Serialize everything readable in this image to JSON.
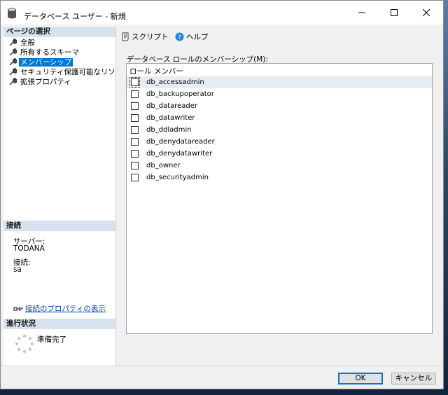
{
  "window": {
    "title": "データベース ユーザー - 新規"
  },
  "left": {
    "select_page_header": "ページの選択",
    "pages": [
      {
        "label": "全般"
      },
      {
        "label": "所有するスキーマ"
      },
      {
        "label": "メンバーシップ"
      },
      {
        "label": "セキュリティ保護可能なリソース"
      },
      {
        "label": "拡張プロパティ"
      }
    ],
    "connection_header": "接続",
    "server_label": "サーバー:",
    "server_value": "TODANA",
    "connection_label": "接続:",
    "connection_value": "sa",
    "view_properties_link": "接続のプロパティの表示",
    "progress_header": "進行状況",
    "progress_status": "準備完了"
  },
  "toolbar": {
    "script_label": "スクリプト",
    "help_label": "ヘルプ"
  },
  "membership": {
    "group_label": "データベース ロールのメンバーシップ(M):",
    "column_header": "ロール メンバー",
    "roles": [
      {
        "name": "db_accessadmin",
        "checked": false
      },
      {
        "name": "db_backupoperator",
        "checked": false
      },
      {
        "name": "db_datareader",
        "checked": false
      },
      {
        "name": "db_datawriter",
        "checked": false
      },
      {
        "name": "db_ddladmin",
        "checked": false
      },
      {
        "name": "db_denydatareader",
        "checked": false
      },
      {
        "name": "db_denydatawriter",
        "checked": false
      },
      {
        "name": "db_owner",
        "checked": false
      },
      {
        "name": "db_securityadmin",
        "checked": false
      }
    ]
  },
  "footer": {
    "ok_label": "OK",
    "cancel_label": "キャンセル"
  },
  "colors": {
    "accent": "#0078d7",
    "section_header": "#d6e3ef",
    "link": "#0645ad"
  }
}
